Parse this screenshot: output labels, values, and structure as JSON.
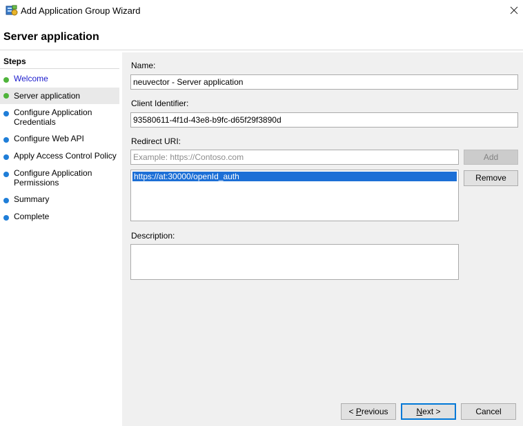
{
  "window": {
    "title": "Add Application Group Wizard"
  },
  "page": {
    "title": "Server application"
  },
  "steps": {
    "heading": "Steps",
    "items": [
      {
        "label": "Welcome",
        "state": "done"
      },
      {
        "label": "Server application",
        "state": "current"
      },
      {
        "label": "Configure Application\nCredentials",
        "state": "todo"
      },
      {
        "label": "Configure Web API",
        "state": "todo"
      },
      {
        "label": "Apply Access Control Policy",
        "state": "todo"
      },
      {
        "label": "Configure Application\nPermissions",
        "state": "todo"
      },
      {
        "label": "Summary",
        "state": "todo"
      },
      {
        "label": "Complete",
        "state": "todo"
      }
    ]
  },
  "form": {
    "name_label": "Name:",
    "name_value": "neuvector - Server application",
    "client_id_label": "Client Identifier:",
    "client_id_value": "93580611-4f1d-43e8-b9fc-d65f29f3890d",
    "redirect_label": "Redirect URI:",
    "redirect_placeholder": "Example: https://Contoso.com",
    "redirect_list": [
      "https://at:30000/openId_auth"
    ],
    "add_label": "Add",
    "remove_label": "Remove",
    "description_label": "Description:",
    "description_value": ""
  },
  "footer": {
    "previous_prefix": "< ",
    "previous_underlined": "P",
    "previous_suffix": "revious",
    "next_underlined": "N",
    "next_suffix": "ext >",
    "cancel_label": "Cancel"
  },
  "colors": {
    "step_done": "#4fb43b",
    "step_todo": "#1f7ed8",
    "selection": "#1c6fd6",
    "link": "#1a1acc"
  },
  "icons": {
    "app": "application-group-icon",
    "close": "close-icon"
  }
}
